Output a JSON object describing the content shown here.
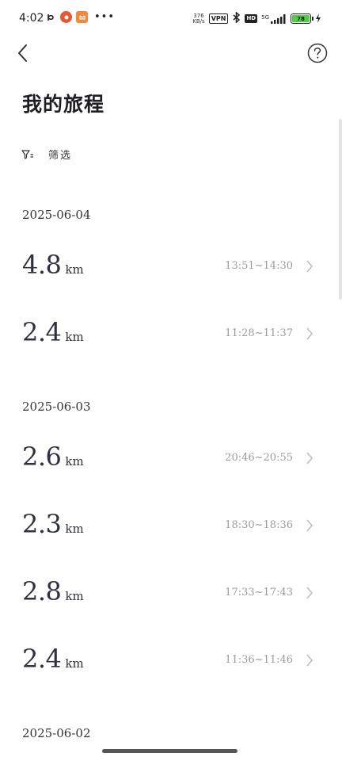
{
  "status_bar": {
    "time": "4:02",
    "net_speed_value": "376",
    "net_speed_unit": "KB/s",
    "vpn": "VPN",
    "hd": "HD",
    "signal_type": "5G",
    "battery": "78",
    "battery_color": "#4cd13f"
  },
  "nav": {
    "back_icon": "chevron-left-icon",
    "help_icon": "question-circle-icon"
  },
  "page_title": "我的旅程",
  "filter": {
    "icon": "filter-icon",
    "label": "筛选"
  },
  "groups": [
    {
      "date": "2025-06-04",
      "trips": [
        {
          "distance": "4.8",
          "unit": "km",
          "time": "13:51~14:30"
        },
        {
          "distance": "2.4",
          "unit": "km",
          "time": "11:28~11:37"
        }
      ]
    },
    {
      "date": "2025-06-03",
      "trips": [
        {
          "distance": "2.6",
          "unit": "km",
          "time": "20:46~20:55"
        },
        {
          "distance": "2.3",
          "unit": "km",
          "time": "18:30~18:36"
        },
        {
          "distance": "2.8",
          "unit": "km",
          "time": "17:33~17:43"
        },
        {
          "distance": "2.4",
          "unit": "km",
          "time": "11:36~11:46"
        }
      ]
    },
    {
      "date": "2025-06-02",
      "trips": []
    }
  ]
}
